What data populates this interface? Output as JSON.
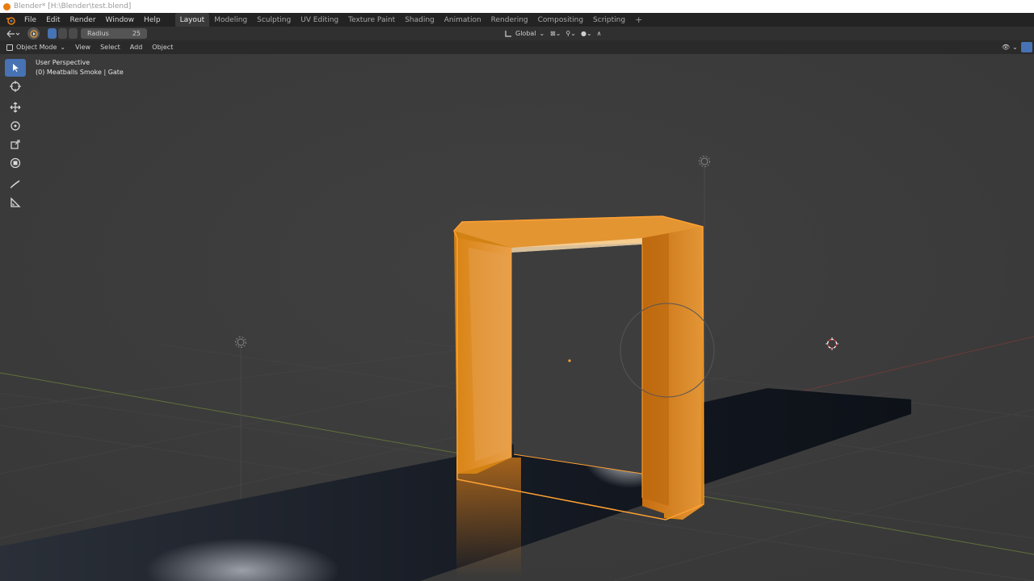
{
  "window": {
    "title": "Blender* [H:\\Blender\\test.blend]"
  },
  "menu": {
    "items": [
      "File",
      "Edit",
      "Render",
      "Window",
      "Help"
    ],
    "workspaces": [
      "Layout",
      "Modeling",
      "Sculpting",
      "UV Editing",
      "Texture Paint",
      "Shading",
      "Animation",
      "Rendering",
      "Compositing",
      "Scripting"
    ],
    "active_workspace": "Layout",
    "add_symbol": "+"
  },
  "tool_header": {
    "radius_label": "Radius",
    "radius_value": "25",
    "orientation": "Global"
  },
  "viewport_header": {
    "mode": "Object Mode",
    "menus": [
      "View",
      "Select",
      "Add",
      "Object"
    ]
  },
  "viewport": {
    "view_name": "User Perspective",
    "collection_info": "(0) Meatballs Smoke | Gate"
  },
  "tools": [
    "select-box-icon",
    "cursor-icon",
    "move-icon",
    "rotate-icon",
    "scale-icon",
    "transform-icon",
    "annotate-icon",
    "measure-icon"
  ],
  "colors": {
    "accent": "#4772b3",
    "selection": "#ffa033",
    "gate": "#d98416",
    "background": "#3d3d3d"
  }
}
